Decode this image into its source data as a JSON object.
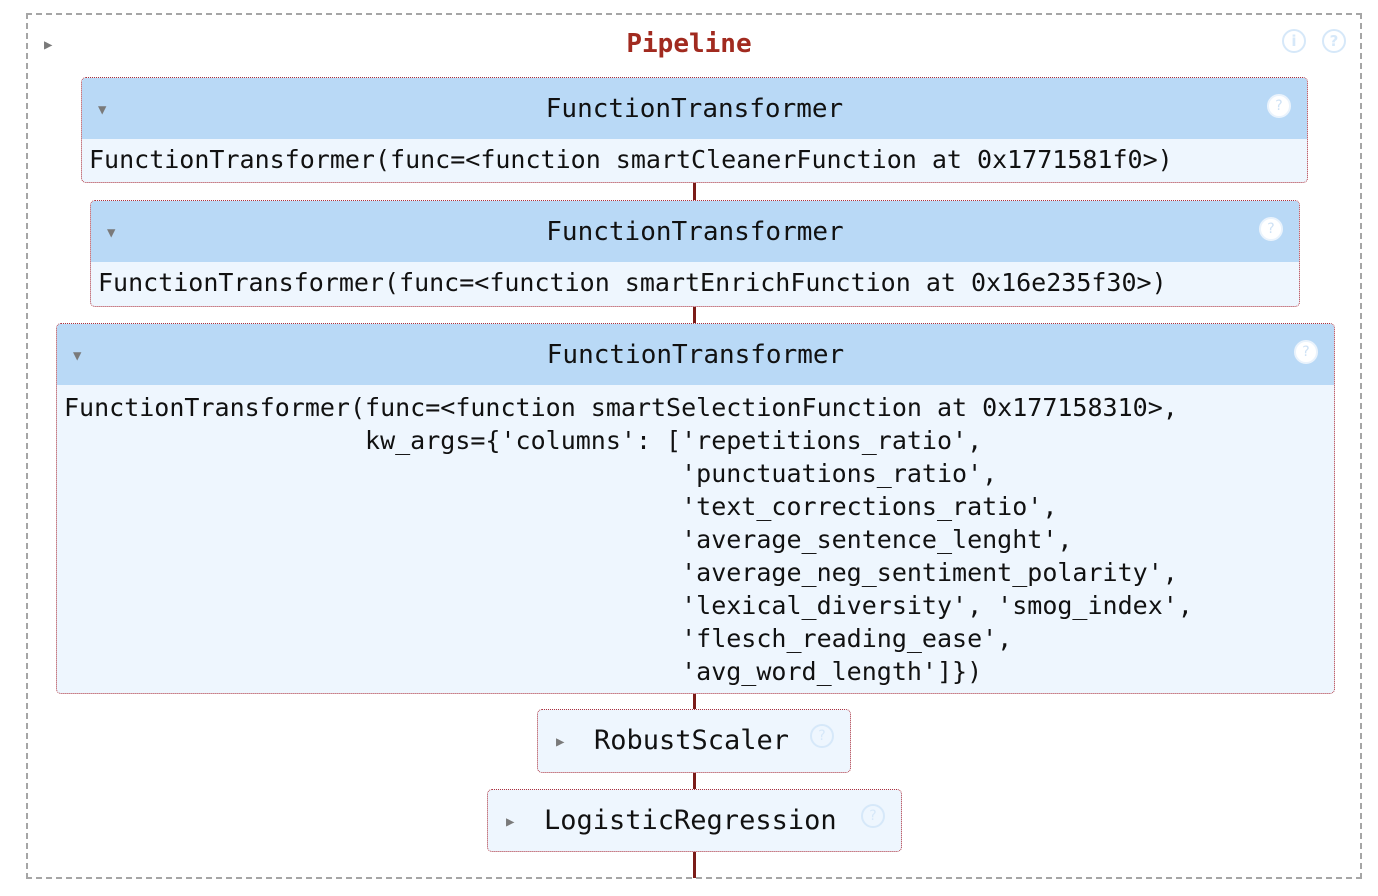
{
  "pipeline": {
    "toggle_glyph": "▶",
    "title": "Pipeline",
    "info_glyph": "i",
    "help_glyph": "?"
  },
  "steps": [
    {
      "toggle_glyph": "▼",
      "name": "FunctionTransformer",
      "help_glyph": "?",
      "code": "FunctionTransformer(func=<function smartCleanerFunction at 0x1771581f0>)"
    },
    {
      "toggle_glyph": "▼",
      "name": "FunctionTransformer",
      "help_glyph": "?",
      "code": "FunctionTransformer(func=<function smartEnrichFunction at 0x16e235f30>)"
    },
    {
      "toggle_glyph": "▼",
      "name": "FunctionTransformer",
      "help_glyph": "?",
      "code": "FunctionTransformer(func=<function smartSelectionFunction at 0x177158310>,\n                    kw_args={'columns': ['repetitions_ratio',\n                                         'punctuations_ratio',\n                                         'text_corrections_ratio',\n                                         'average_sentence_lenght',\n                                         'average_neg_sentiment_polarity',\n                                         'lexical_diversity', 'smog_index',\n                                         'flesch_reading_ease',\n                                         'avg_word_length']})"
    },
    {
      "toggle_glyph": "▶",
      "name": "RobustScaler",
      "help_glyph": "?"
    },
    {
      "toggle_glyph": "▶",
      "name": "LogisticRegression",
      "help_glyph": "?"
    }
  ]
}
